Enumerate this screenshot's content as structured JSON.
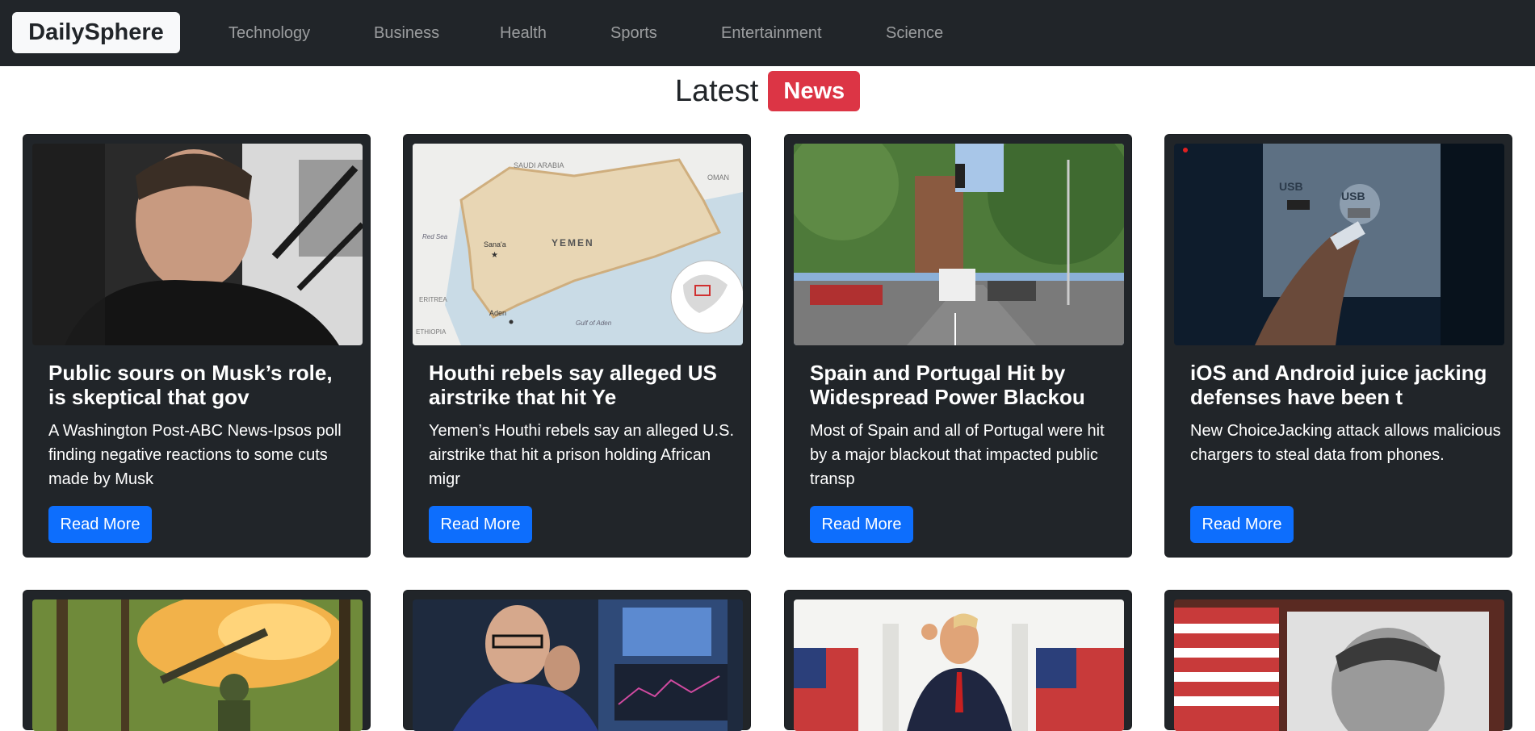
{
  "brand": "DailySphere",
  "nav": {
    "items": [
      "Technology",
      "Business",
      "Health",
      "Sports",
      "Entertainment",
      "Science"
    ]
  },
  "heading": {
    "text": "Latest",
    "badge": "News"
  },
  "colors": {
    "navbar": "#212529",
    "badge": "#dc3545",
    "button": "#0d6efd",
    "card": "#212529"
  },
  "cards": [
    {
      "title": "Public sours on Musk’s role, is skeptical that gov",
      "text": "A Washington Post-ABC News-Ipsos poll finding negative reactions to some cuts made by Musk",
      "button": "Read More"
    },
    {
      "title": "Houthi rebels say alleged US airstrike that hit Ye",
      "text": "Yemen’s Houthi rebels say an alleged U.S. airstrike that hit a prison holding African migr",
      "button": "Read More",
      "map_labels": {
        "a": "SAUDI ARABIA",
        "b": "OMAN",
        "c": "YEMEN",
        "d": "Sana'a",
        "e": "Red Sea",
        "f": "ERITREA",
        "g": "ETHIOPIA",
        "h": "Aden",
        "i": "Gulf of Aden"
      }
    },
    {
      "title": "Spain and Portugal Hit by Widespread Power Blackou",
      "text": "Most of Spain and all of Portugal were hit by a major blackout that impacted public transp",
      "button": "Read More"
    },
    {
      "title": "iOS and Android juice jacking defenses have been t",
      "text": "New ChoiceJacking attack allows malicious chargers to steal data from phones.",
      "button": "Read More",
      "image_labels": {
        "left": "USB",
        "right": "USB"
      }
    }
  ]
}
